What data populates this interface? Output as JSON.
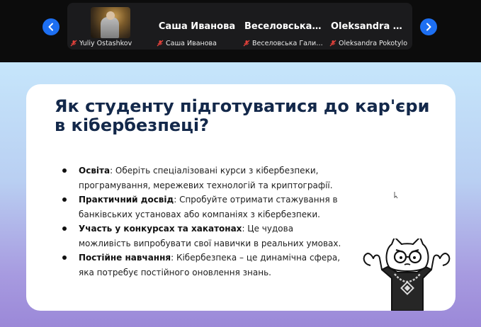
{
  "participants": [
    {
      "name": "",
      "label": "Yuliy Ostashkov",
      "has_video": true
    },
    {
      "name": "Саша Иванова",
      "label": "Саша Иванова",
      "has_video": false
    },
    {
      "name": "Веселовська Га...",
      "label": "Веселовська Галина В...",
      "has_video": false
    },
    {
      "name": "Oleksandra Pok...",
      "label": "Oleksandra Pokotylo",
      "has_video": false
    }
  ],
  "icons": {
    "prev": "chevron-left-icon",
    "next": "chevron-right-icon",
    "mic": "mic-muted-icon"
  },
  "slide": {
    "title": "Як студенту підготуватися до кар'єри в кібербезпеці?",
    "bullets": [
      {
        "bold": "Освіта",
        "text": ": Оберіть спеціалізовані курси з кібербезпеки, програмування, мережевих технологій та криптографії."
      },
      {
        "bold": "Практичний досвід",
        "text": ": Спробуйте отримати стажування в банківських установах або компаніях з кібербезпеки."
      },
      {
        "bold": "Участь у конкурсах та хакатонах",
        "text": ": Це чудова можливість випробувати свої навички в реальних умовах."
      },
      {
        "bold": "Постійне навчання",
        "text": ": Кібербезпека – це динамічна сфера, яка потребує постійного оновлення знань."
      }
    ]
  },
  "colors": {
    "nav_button": "#1d6ff2",
    "title": "#13284a",
    "mic_muted": "#e0403a"
  }
}
